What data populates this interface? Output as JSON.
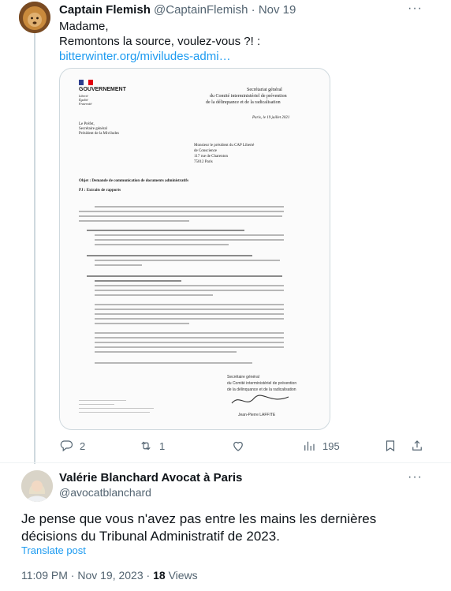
{
  "tweet": {
    "author_name": "Captain Flemish",
    "author_handle": "@CaptainFlemish",
    "separator": "·",
    "date": "Nov 19",
    "more_label": "···",
    "text_line1": "Madame,",
    "text_line2": "Remontons la source, voulez-vous ?! :",
    "link": "bitterwinter.org/miviludes-admi…",
    "stats": {
      "replies": "2",
      "reposts": "1",
      "views": "195"
    }
  },
  "document": {
    "brand": "GOUVERNEMENT",
    "motto": [
      "Liberté",
      "Égalité",
      "Fraternité"
    ],
    "org_lines": [
      "Secrétariat général",
      "du Comité interministériel de prévention",
      "de la délinquance et de la radicalisation"
    ],
    "date_line": "Paris, le 19 juillet 2021",
    "sender_lines": [
      "Le Préfet,",
      "Secrétaire général",
      "Président de la Miviludes"
    ],
    "recipient_lines": [
      "Monsieur le président du CAP Liberté",
      "de Conscience",
      "117 rue de Charenton",
      "75012 Paris"
    ],
    "objet": "Objet : Demande de communication de documents administratifs",
    "pj": "PJ : Extraits de rapports",
    "signature_lines": [
      "Secrétaire général",
      "du Comité interministériel de prévention",
      "de la délinquance et de la radicalisation",
      "Jean-Pierre LAFFITE"
    ]
  },
  "reply": {
    "author_name": "Valérie Blanchard Avocat à Paris",
    "author_handle": "@avocatblanchard",
    "more_label": "···",
    "text": "Je pense que vous n'avez pas entre les mains les dernières décisions du Tribunal Administratif de 2023.",
    "translate": "Translate post",
    "time": "11:09 PM",
    "separator": "·",
    "date": "Nov 19, 2023",
    "views_count": "18",
    "views_label": "Views"
  },
  "colors": {
    "accent": "#1d9bf0",
    "muted": "#536471",
    "border": "#cfd9de"
  }
}
